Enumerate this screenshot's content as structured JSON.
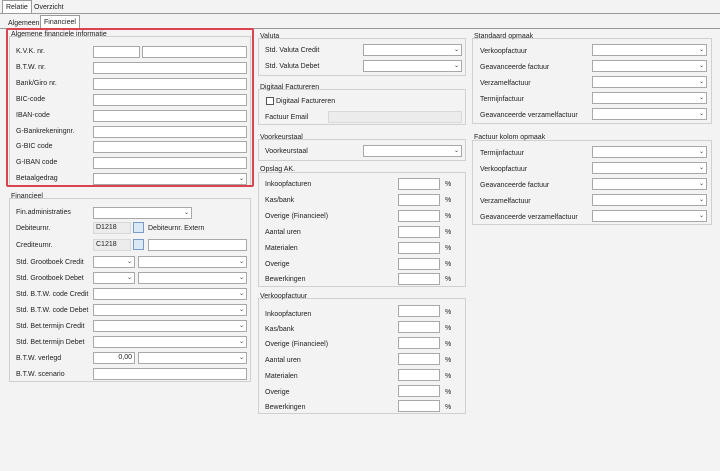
{
  "tabs_top": [
    {
      "label": "Relatie",
      "active": true
    },
    {
      "label": "Overzicht",
      "active": false
    }
  ],
  "tabs_sub": [
    {
      "label": "Algemeen",
      "active": false
    },
    {
      "label": "Financieel",
      "active": true
    }
  ],
  "alg": {
    "title": "Algemene financiele informatie",
    "rows": [
      {
        "label": "K.V.K. nr."
      },
      {
        "label": "B.T.W. nr."
      },
      {
        "label": "Bank/Giro nr."
      },
      {
        "label": "BIC-code"
      },
      {
        "label": "IBAN-code"
      },
      {
        "label": "G-Bankrekeningnr."
      },
      {
        "label": "G-BIC code"
      },
      {
        "label": "G-IBAN code"
      },
      {
        "label": "Betaalgedrag"
      }
    ]
  },
  "fin": {
    "title": "Financieel",
    "rows": [
      {
        "label": "Fin.administraties"
      },
      {
        "label": "Debiteurnr.",
        "value": "D1218",
        "extra": "Debiteurnr. Extern"
      },
      {
        "label": "Crediteurnr.",
        "value": "C1218"
      },
      {
        "label": "Std. Grootboek Credit"
      },
      {
        "label": "Std. Grootboek Debet"
      },
      {
        "label": "Std. B.T.W. code Credit"
      },
      {
        "label": "Std. B.T.W. code Debet"
      },
      {
        "label": "Std. Bet.termijn Credit"
      },
      {
        "label": "Std. Bet.termijn Debet"
      },
      {
        "label": "B.T.W. verlegd",
        "value": "0,00"
      },
      {
        "label": "B.T.W. scenario"
      }
    ]
  },
  "valuta": {
    "title": "Valuta",
    "rows": [
      {
        "label": "Std. Valuta Credit"
      },
      {
        "label": "Std. Valuta Debet"
      }
    ]
  },
  "digitaal": {
    "title": "Digitaal Factureren",
    "checkbox_label": "Digitaal Factureren",
    "email_label": "Factuur Email"
  },
  "voorkeur": {
    "title": "Voorkeurstaal",
    "label": "Voorkeurstaal"
  },
  "opslag": {
    "title": "Opslag AK.",
    "unit": "%",
    "rows": [
      {
        "label": "Inkoopfacturen"
      },
      {
        "label": "Kas/bank"
      },
      {
        "label": "Overige (Financieel)"
      },
      {
        "label": "Aantal uren"
      },
      {
        "label": "Materialen"
      },
      {
        "label": "Overige"
      },
      {
        "label": "Bewerkingen"
      }
    ]
  },
  "verkoop": {
    "title": "Verkoopfactuur",
    "unit": "%",
    "rows": [
      {
        "label": "Inkoopfacturen"
      },
      {
        "label": "Kas/bank"
      },
      {
        "label": "Overige (Financieel)"
      },
      {
        "label": "Aantal uren"
      },
      {
        "label": "Materialen"
      },
      {
        "label": "Overige"
      },
      {
        "label": "Bewerkingen"
      }
    ]
  },
  "standaard": {
    "title": "Standaard opmaak",
    "rows": [
      {
        "label": "Verkoopfactuur"
      },
      {
        "label": "Geavanceerde factuur"
      },
      {
        "label": "Verzamelfactuur"
      },
      {
        "label": "Termijnfactuur"
      },
      {
        "label": "Geavanceerde verzamelfactuur"
      }
    ]
  },
  "kolom": {
    "title": "Factuur kolom opmaak",
    "rows": [
      {
        "label": "Termijnfactuur"
      },
      {
        "label": "Verkoopfactuur"
      },
      {
        "label": "Geavanceerde factuur"
      },
      {
        "label": "Verzamelfactuur"
      },
      {
        "label": "Geavanceerde verzamelfactuur"
      }
    ]
  },
  "icons": {
    "dropdown": "chevron-down-icon",
    "lookup": "edit-lookup-icon"
  },
  "colors": {
    "highlight": "#d9444e"
  }
}
